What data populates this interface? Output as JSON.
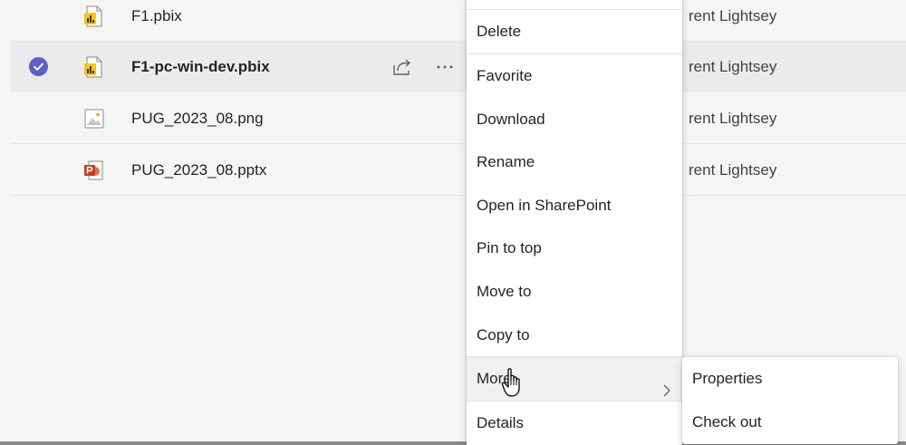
{
  "files": [
    {
      "name": "F1.pbix",
      "type": "pbix",
      "modified_by": "rent Lightsey",
      "selected": false
    },
    {
      "name": "F1-pc-win-dev.pbix",
      "type": "pbix",
      "modified_by": "rent Lightsey",
      "selected": true
    },
    {
      "name": "PUG_2023_08.png",
      "type": "png",
      "modified_by": "rent Lightsey",
      "selected": false
    },
    {
      "name": "PUG_2023_08.pptx",
      "type": "pptx",
      "modified_by": "rent Lightsey",
      "selected": false
    }
  ],
  "row_actions": {
    "share_icon": "share-icon",
    "more_icon": "more-options-icon"
  },
  "context_menu": {
    "items": [
      {
        "label": "Delete"
      },
      {
        "label": "Favorite"
      },
      {
        "label": "Download"
      },
      {
        "label": "Rename"
      },
      {
        "label": "Open in SharePoint"
      },
      {
        "label": "Pin to top"
      },
      {
        "label": "Move to"
      },
      {
        "label": "Copy to"
      },
      {
        "label": "More",
        "has_submenu": true,
        "hovered": true
      },
      {
        "label": "Details"
      }
    ]
  },
  "submenu": {
    "items": [
      {
        "label": "Properties"
      },
      {
        "label": "Check out"
      }
    ]
  },
  "colors": {
    "accent": "#5b5fc7",
    "pbix_icon": "#f2c811",
    "pptx_icon": "#c43e1c",
    "selected_row": "#ebebeb",
    "background": "#f5f5f5"
  }
}
